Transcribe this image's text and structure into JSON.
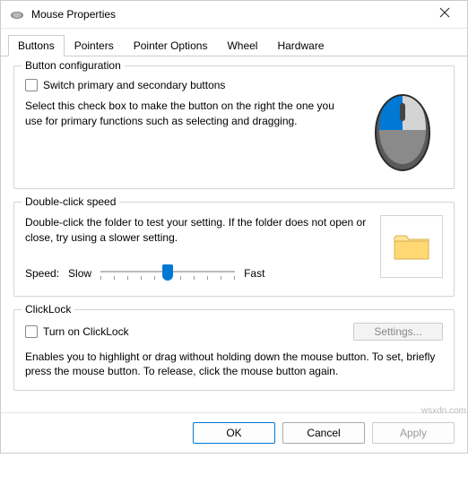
{
  "window": {
    "title": "Mouse Properties"
  },
  "tabs": {
    "buttons": "Buttons",
    "pointers": "Pointers",
    "pointer_options": "Pointer Options",
    "wheel": "Wheel",
    "hardware": "Hardware"
  },
  "button_config": {
    "title": "Button configuration",
    "checkbox_label": "Switch primary and secondary buttons",
    "desc": "Select this check box to make the button on the right the one you use for primary functions such as selecting and dragging."
  },
  "double_click": {
    "title": "Double-click speed",
    "desc": "Double-click the folder to test your setting. If the folder does not open or close, try using a slower setting.",
    "speed_label": "Speed:",
    "slow": "Slow",
    "fast": "Fast"
  },
  "clicklock": {
    "title": "ClickLock",
    "checkbox_label": "Turn on ClickLock",
    "settings_btn": "Settings...",
    "desc": "Enables you to highlight or drag without holding down the mouse button. To set, briefly press the mouse button. To release, click the mouse button again."
  },
  "buttons": {
    "ok": "OK",
    "cancel": "Cancel",
    "apply": "Apply"
  },
  "watermark": "wsxdn.com"
}
